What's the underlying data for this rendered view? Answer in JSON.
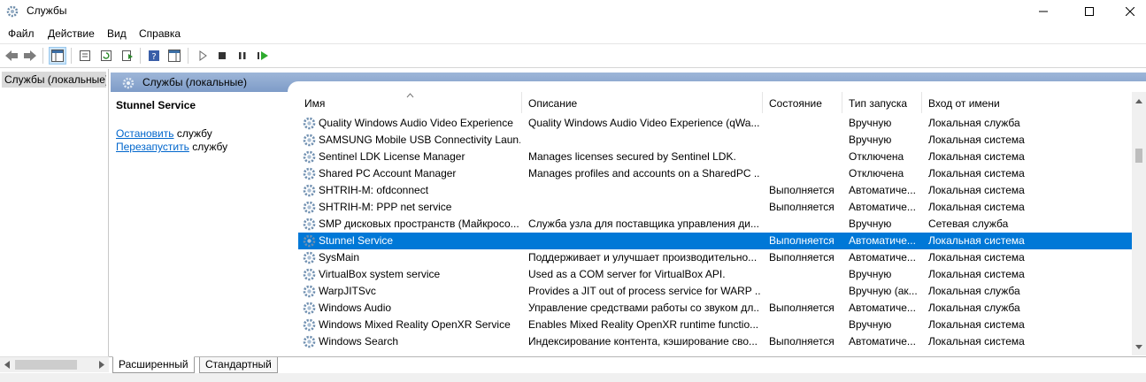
{
  "window": {
    "title": "Службы",
    "minimize": "minimize",
    "maximize": "maximize",
    "close": "close"
  },
  "menu": [
    "Файл",
    "Действие",
    "Вид",
    "Справка"
  ],
  "tree": {
    "root_label": "Службы (локальные)"
  },
  "panel": {
    "header": "Службы (локальные)"
  },
  "selected_service": {
    "name": "Stunnel Service",
    "stop_link": "Остановить",
    "stop_suffix": " службу",
    "restart_link": "Перезапустить",
    "restart_suffix": " службу"
  },
  "table": {
    "columns": [
      "Имя",
      "Описание",
      "Состояние",
      "Тип запуска",
      "Вход от имени"
    ],
    "rows": [
      {
        "name": "Quality Windows Audio Video Experience",
        "description": "Quality Windows Audio Video Experience (qWa...",
        "state": "",
        "startup": "Вручную",
        "logon": "Локальная служба"
      },
      {
        "name": "SAMSUNG Mobile USB Connectivity Laun...",
        "description": "",
        "state": "",
        "startup": "Вручную",
        "logon": "Локальная система"
      },
      {
        "name": "Sentinel LDK License Manager",
        "description": "Manages licenses secured by Sentinel LDK.",
        "state": "",
        "startup": "Отключена",
        "logon": "Локальная система"
      },
      {
        "name": "Shared PC Account Manager",
        "description": "Manages profiles and accounts on a SharedPC ...",
        "state": "",
        "startup": "Отключена",
        "logon": "Локальная система"
      },
      {
        "name": "SHTRIH-M: ofdconnect",
        "description": "",
        "state": "Выполняется",
        "startup": "Автоматиче...",
        "logon": "Локальная система"
      },
      {
        "name": "SHTRIH-M: PPP net service",
        "description": "",
        "state": "Выполняется",
        "startup": "Автоматиче...",
        "logon": "Локальная система"
      },
      {
        "name": "SMP дисковых пространств (Майкросо...",
        "description": "Служба узла для поставщика управления ди...",
        "state": "",
        "startup": "Вручную",
        "logon": "Сетевая служба"
      },
      {
        "name": "Stunnel Service",
        "description": "",
        "state": "Выполняется",
        "startup": "Автоматиче...",
        "logon": "Локальная система",
        "selected": true
      },
      {
        "name": "SysMain",
        "description": "Поддерживает и улучшает производительно...",
        "state": "Выполняется",
        "startup": "Автоматиче...",
        "logon": "Локальная система"
      },
      {
        "name": "VirtualBox system service",
        "description": "Used as a COM server for VirtualBox API.",
        "state": "",
        "startup": "Вручную",
        "logon": "Локальная система"
      },
      {
        "name": "WarpJITSvc",
        "description": "Provides a JIT out of process service for WARP ...",
        "state": "",
        "startup": "Вручную (ак...",
        "logon": "Локальная служба"
      },
      {
        "name": "Windows Audio",
        "description": "Управление средствами работы со звуком дл...",
        "state": "Выполняется",
        "startup": "Автоматиче...",
        "logon": "Локальная служба"
      },
      {
        "name": "Windows Mixed Reality OpenXR Service",
        "description": "Enables Mixed Reality OpenXR runtime functio...",
        "state": "",
        "startup": "Вручную",
        "logon": "Локальная система"
      },
      {
        "name": "Windows Search",
        "description": "Индексирование контента, кэширование сво...",
        "state": "Выполняется",
        "startup": "Автоматиче...",
        "logon": "Локальная система"
      }
    ]
  },
  "tabs": [
    "Расширенный",
    "Стандартный"
  ],
  "colors": {
    "selection": "#0078d7",
    "header_band": "#8fa9d0",
    "link": "#0066cc"
  },
  "icons": [
    "gear-icon",
    "back-icon",
    "forward-icon",
    "play-icon",
    "stop-icon",
    "pause-icon",
    "resume-icon",
    "help-icon"
  ]
}
